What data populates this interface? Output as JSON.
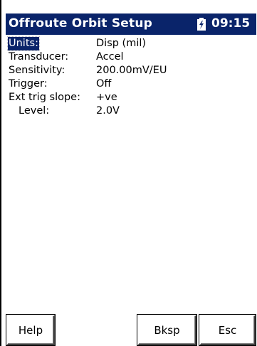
{
  "title_bar": {
    "title": "Offroute Orbit Setup",
    "time": "09:15",
    "battery_icon": "battery-charging-icon",
    "background_color": "#0a246a",
    "text_color": "#ffffff"
  },
  "settings": {
    "rows": [
      {
        "label": "Units:",
        "value": "Disp (mil)",
        "selected": true
      },
      {
        "label": "Transducer:",
        "value": "Accel"
      },
      {
        "label": "Sensitivity:",
        "value": "200.00mV/EU"
      },
      {
        "label": "Trigger:",
        "value": "Off"
      },
      {
        "label": "Ext trig slope:",
        "value": "+ve"
      },
      {
        "label": "Level:",
        "value": "2.0V"
      }
    ]
  },
  "softkeys": {
    "help": "Help",
    "bksp": "Bksp",
    "esc": "Esc"
  }
}
